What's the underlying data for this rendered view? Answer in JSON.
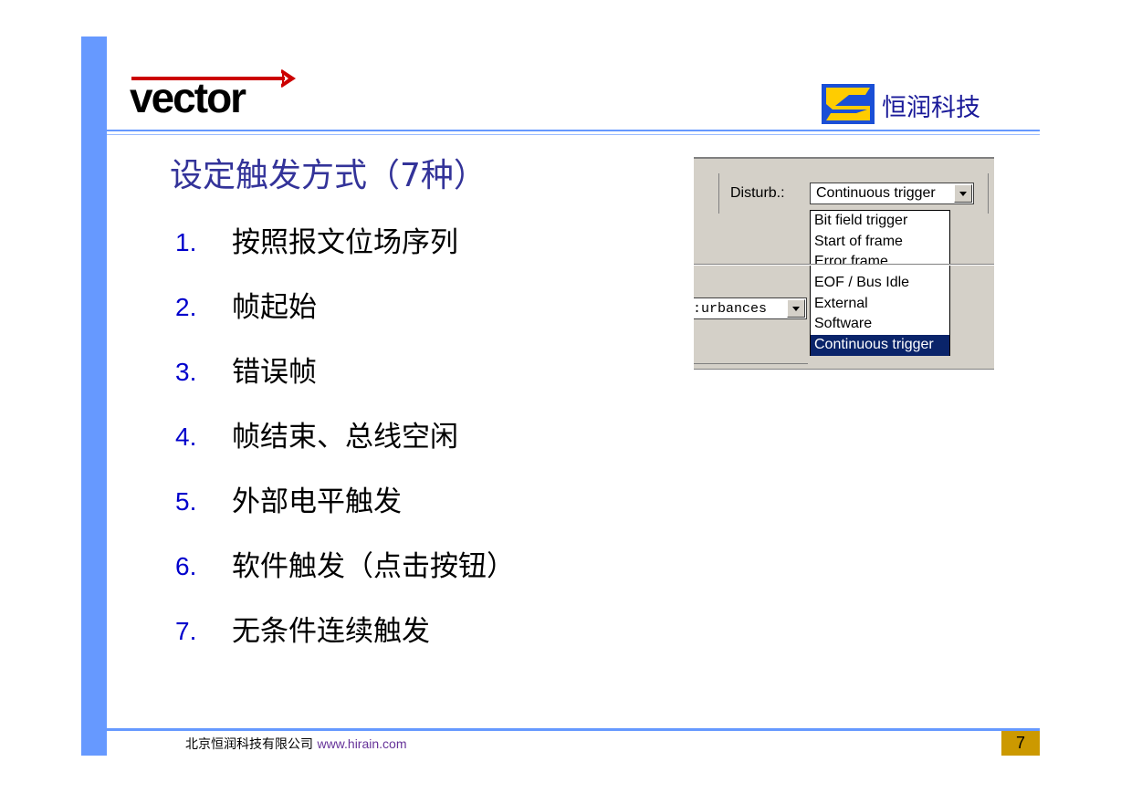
{
  "header": {
    "left_logo_text": "vector",
    "right_logo_text": "恒润科技"
  },
  "slide": {
    "title": "设定触发方式（7种）",
    "items": [
      {
        "num": "1.",
        "text": "按照报文位场序列"
      },
      {
        "num": "2.",
        "text": "帧起始"
      },
      {
        "num": "3.",
        "text": "错误帧"
      },
      {
        "num": "4.",
        "text": "帧结束、总线空闲"
      },
      {
        "num": "5.",
        "text": "外部电平触发"
      },
      {
        "num": "6.",
        "text": "软件触发（点击按钮）"
      },
      {
        "num": "7.",
        "text": "无条件连续触发"
      }
    ]
  },
  "screenshot": {
    "disturb_label": "Disturb.:",
    "combo_value": "Continuous trigger",
    "options": [
      "Bit field trigger",
      "Start of frame",
      "Error frame",
      "EOF / Bus Idle",
      "External",
      "Software",
      "Continuous trigger"
    ],
    "selected_index": 6,
    "second_combo_value": ":urbances"
  },
  "footer": {
    "company": "北京恒润科技有限公司",
    "url": "www.hirain.com",
    "page": "7"
  },
  "colors": {
    "accent_bar": "#6699ff",
    "title": "#333399",
    "number": "#0000cc",
    "page_badge": "#cc9900"
  }
}
